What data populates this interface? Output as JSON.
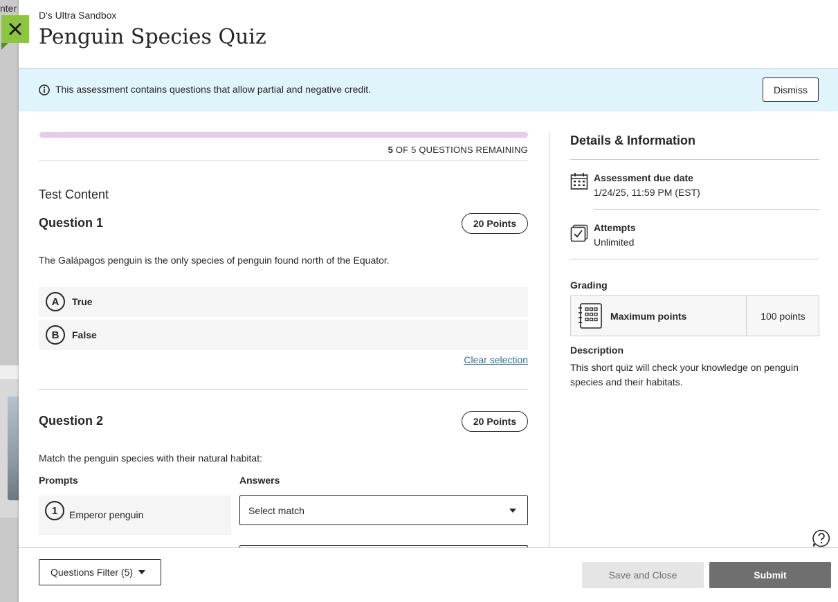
{
  "background_page": {
    "partial_text": "nter"
  },
  "close": {
    "icon": "close-icon"
  },
  "header": {
    "course_name": "D's Ultra Sandbox",
    "title": "Penguin Species Quiz"
  },
  "banner": {
    "icon": "info-icon",
    "message": "This assessment contains questions that allow partial and negative credit.",
    "dismiss_label": "Dismiss",
    "background": "#dff4fb"
  },
  "progress": {
    "remaining_count": "5",
    "remaining_suffix": " OF 5 QUESTIONS REMAINING",
    "answered_fraction": 0,
    "bar_color": "#e8c9ef"
  },
  "content": {
    "section_title": "Test Content",
    "questions": [
      {
        "title": "Question 1",
        "points": "20 Points",
        "text": "The Galápagos penguin is the only species of penguin found north of the Equator.",
        "options": [
          {
            "letter": "A",
            "label": "True"
          },
          {
            "letter": "B",
            "label": "False"
          }
        ],
        "clear_label": "Clear selection"
      },
      {
        "title": "Question 2",
        "points": "20 Points",
        "text": "Match the penguin species with their natural habitat:",
        "prompts_header": "Prompts",
        "answers_header": "Answers",
        "prompts": [
          {
            "num": "1",
            "label": "Emperor penguin",
            "answer_placeholder": "Select match"
          }
        ]
      }
    ]
  },
  "details": {
    "title": "Details & Information",
    "due_date": {
      "icon": "calendar-icon",
      "label": "Assessment due date",
      "value": "1/24/25, 11:59 PM (EST)"
    },
    "attempts": {
      "icon": "checkbox-icon",
      "label": "Attempts",
      "value": "Unlimited"
    },
    "grading": {
      "label": "Grading",
      "icon": "gradebook-icon",
      "item_label": "Maximum points",
      "item_value": "100 points"
    },
    "description": {
      "label": "Description",
      "text": "This short quiz will check your knowledge on penguin species and their habitats."
    }
  },
  "help": {
    "icon": "help-icon"
  },
  "footer": {
    "filter_label": "Questions Filter (5)",
    "save_label": "Save and Close",
    "submit_label": "Submit",
    "submit_color": "#6f6f6f"
  },
  "accent": "#8cc63e"
}
